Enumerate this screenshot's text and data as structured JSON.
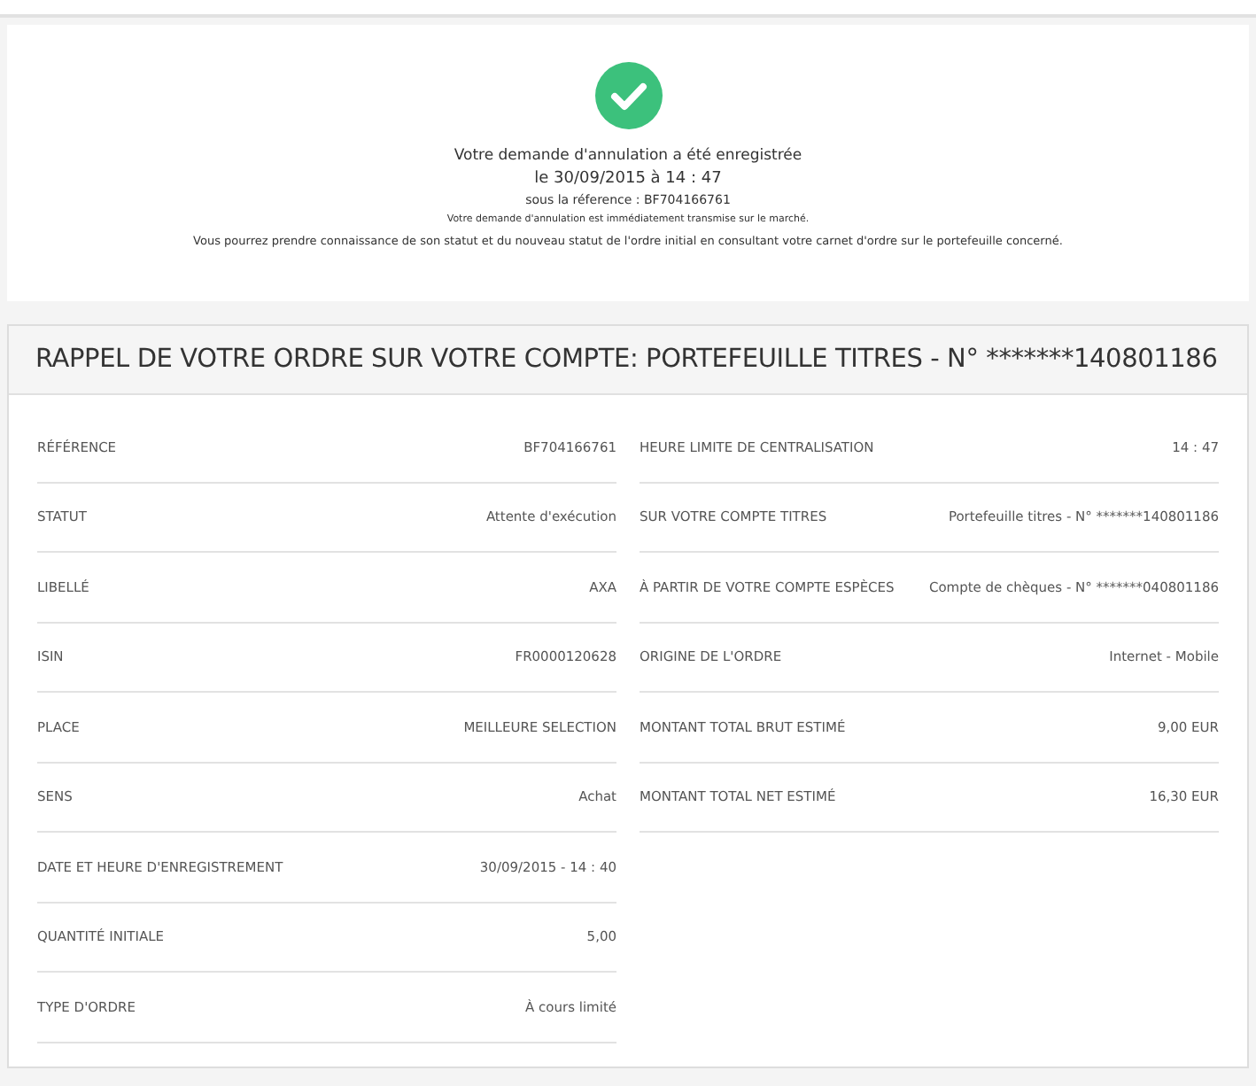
{
  "confirmation": {
    "title": "Votre demande d'annulation a été enregistrée",
    "date": "le 30/09/2015 à 14 : 47",
    "reference": "sous la réference :  BF704166761",
    "notice": "Votre demande d'annulation est immédiatement transmise sur le marché.",
    "info": "Vous pourrez prendre connaissance de son statut et du nouveau statut de l'ordre initial en consultant votre carnet d'ordre sur le portefeuille concerné."
  },
  "order": {
    "title": "RAPPEL DE VOTRE ORDRE SUR VOTRE COMPTE: PORTEFEUILLE TITRES - N° *******140801186",
    "left": [
      {
        "label": "RÉFÉRENCE",
        "value": "BF704166761"
      },
      {
        "label": "STATUT",
        "value": "Attente d'exécution"
      },
      {
        "label": "LIBELLÉ",
        "value": "AXA"
      },
      {
        "label": "ISIN",
        "value": "FR0000120628"
      },
      {
        "label": "PLACE",
        "value": "MEILLEURE SELECTION"
      },
      {
        "label": "SENS",
        "value": "Achat"
      },
      {
        "label": "DATE ET HEURE D'ENREGISTREMENT",
        "value": "30/09/2015 - 14 : 40"
      },
      {
        "label": "QUANTITÉ INITIALE",
        "value": "5,00"
      },
      {
        "label": "TYPE D'ORDRE",
        "value": "À cours limité"
      }
    ],
    "right": [
      {
        "label": "HEURE LIMITE DE CENTRALISATION",
        "value": "14 : 47"
      },
      {
        "label": "SUR VOTRE COMPTE TITRES",
        "value": "Portefeuille titres - N° *******140801186"
      },
      {
        "label": "À PARTIR DE VOTRE COMPTE ESPÈCES",
        "value": "Compte de chèques - N° *******040801186"
      },
      {
        "label": "ORIGINE DE L'ORDRE",
        "value": "Internet - Mobile"
      },
      {
        "label": "MONTANT TOTAL BRUT ESTIMÉ",
        "value": "9,00 EUR"
      },
      {
        "label": "MONTANT TOTAL NET ESTIMÉ",
        "value": "16,30 EUR"
      }
    ]
  }
}
